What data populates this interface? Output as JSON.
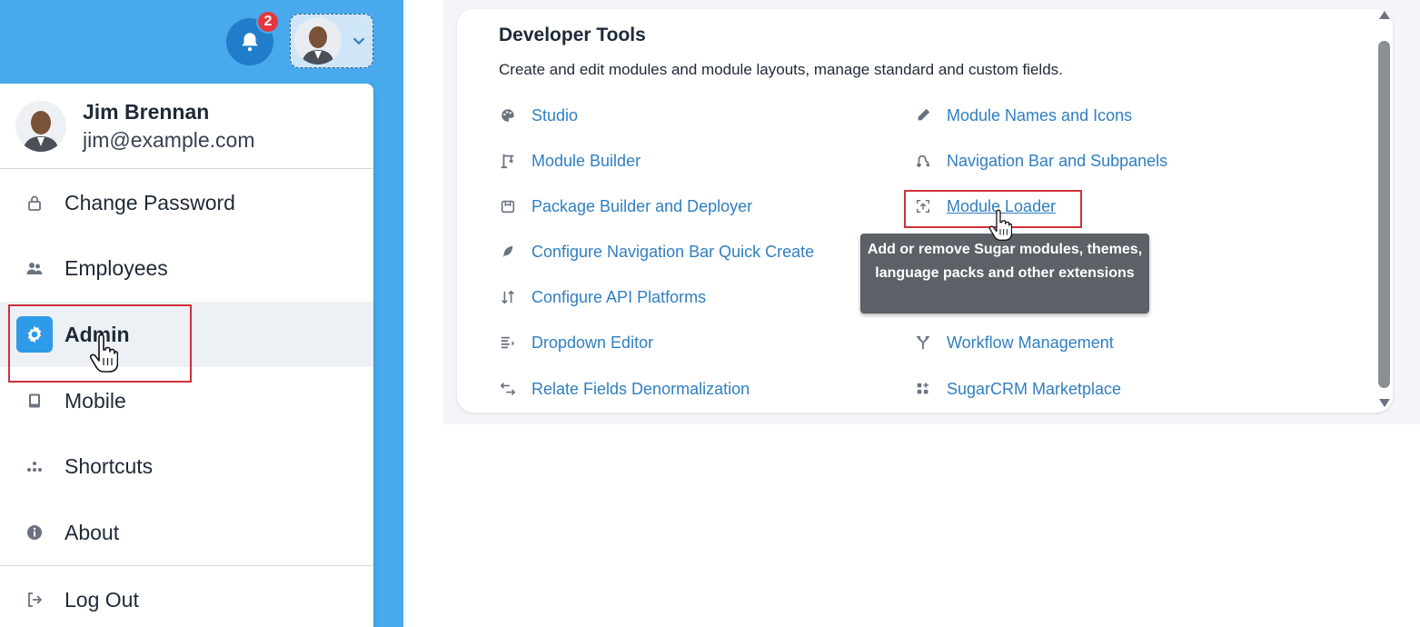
{
  "header": {
    "notification_count": "2"
  },
  "user": {
    "name": "Jim Brennan",
    "email": "jim@example.com"
  },
  "menu": {
    "items": [
      {
        "label": "Change Password",
        "icon": "lock-icon"
      },
      {
        "label": "Employees",
        "icon": "users-icon"
      },
      {
        "label": "Admin",
        "icon": "gear-icon",
        "active": true
      },
      {
        "label": "Mobile",
        "icon": "tablet-icon"
      },
      {
        "label": "Shortcuts",
        "icon": "shortcuts-icon"
      },
      {
        "label": "About",
        "icon": "info-icon"
      },
      {
        "label": "Log Out",
        "icon": "logout-icon"
      }
    ]
  },
  "developer_tools": {
    "title": "Developer Tools",
    "description": "Create and edit modules and module layouts, manage standard and custom fields.",
    "left_column": [
      {
        "label": "Studio",
        "icon": "palette-icon"
      },
      {
        "label": "Module Builder",
        "icon": "crane-icon"
      },
      {
        "label": "Package Builder and Deployer",
        "icon": "package-icon"
      },
      {
        "label": "Configure Navigation Bar Quick Create",
        "icon": "feather-icon"
      },
      {
        "label": "Configure API Platforms",
        "icon": "sort-arrows-icon"
      },
      {
        "label": "Dropdown Editor",
        "icon": "list-arrow-icon"
      },
      {
        "label": "Relate Fields Denormalization",
        "icon": "swap-arrows-icon"
      }
    ],
    "right_column": [
      {
        "label": "Module Names and Icons",
        "icon": "pencil-icon"
      },
      {
        "label": "Navigation Bar and Subpanels",
        "icon": "route-icon"
      },
      {
        "label": "Module Loader",
        "icon": "upload-box-icon",
        "hovered": true
      },
      {
        "label": "Workflow Management",
        "icon": "workflow-icon"
      },
      {
        "label": "SugarCRM Marketplace",
        "icon": "grid-plus-icon"
      }
    ],
    "tooltip": "Add or remove Sugar modules, themes, language packs and other extensions"
  },
  "colors": {
    "sidebar_blue": "#48a9ec",
    "link_blue": "#2f7fc1",
    "active_icon_bg": "#2f9ae8",
    "badge_red": "#e5373e",
    "highlight_red": "#d0303a",
    "tooltip_bg": "#5b6167"
  }
}
